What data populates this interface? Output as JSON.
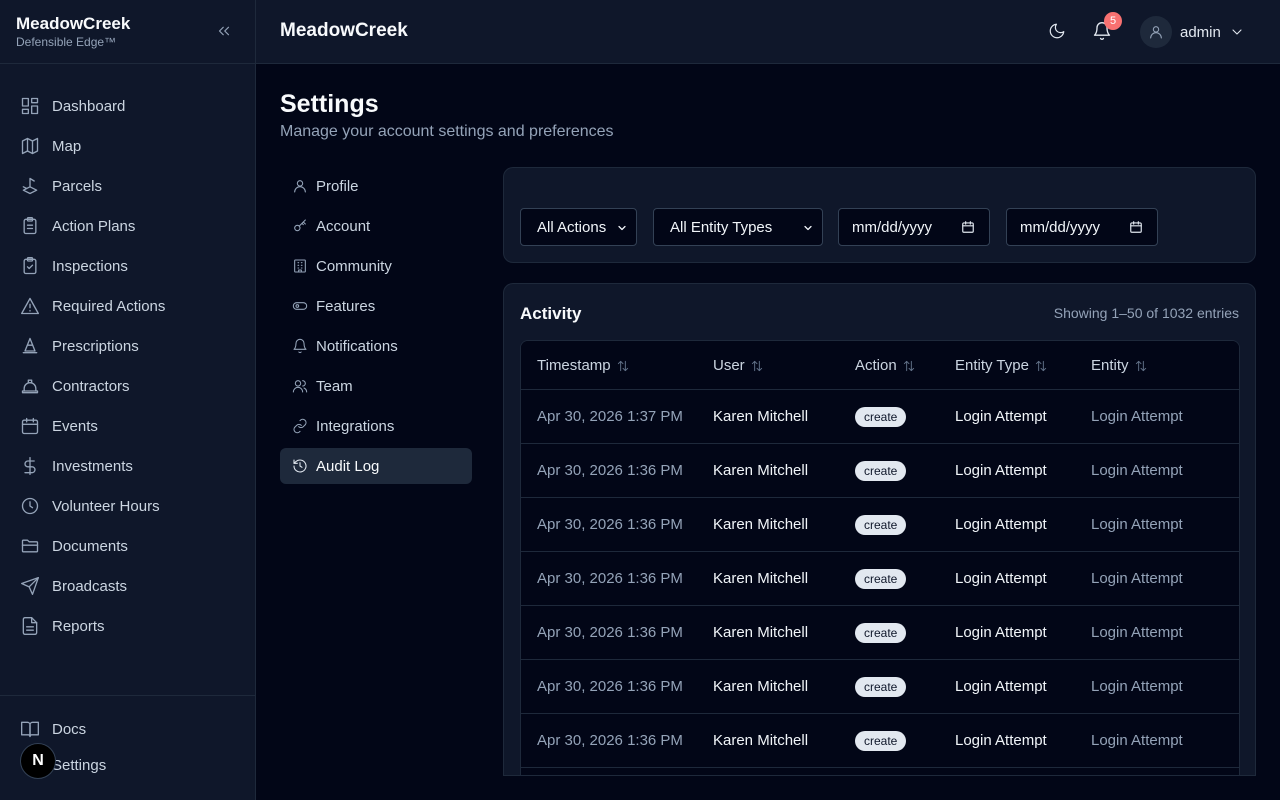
{
  "brand": {
    "title": "MeadowCreek",
    "subtitle": "Defensible Edge™"
  },
  "sidebar": {
    "items": [
      {
        "label": "Dashboard",
        "icon": "dashboard-icon"
      },
      {
        "label": "Map",
        "icon": "map-icon"
      },
      {
        "label": "Parcels",
        "icon": "parcels-icon"
      },
      {
        "label": "Action Plans",
        "icon": "clipboard-icon"
      },
      {
        "label": "Inspections",
        "icon": "clipboard-check-icon"
      },
      {
        "label": "Required Actions",
        "icon": "warning-icon"
      },
      {
        "label": "Prescriptions",
        "icon": "cone-icon"
      },
      {
        "label": "Contractors",
        "icon": "hard-hat-icon"
      },
      {
        "label": "Events",
        "icon": "calendar-icon"
      },
      {
        "label": "Investments",
        "icon": "dollar-icon"
      },
      {
        "label": "Volunteer Hours",
        "icon": "clock-icon"
      },
      {
        "label": "Documents",
        "icon": "folder-icon"
      },
      {
        "label": "Broadcasts",
        "icon": "send-icon"
      },
      {
        "label": "Reports",
        "icon": "file-text-icon"
      }
    ],
    "bottom": [
      {
        "label": "Docs",
        "icon": "book-icon"
      },
      {
        "label": "Settings",
        "icon": "settings-icon"
      }
    ],
    "next_badge": "N"
  },
  "topbar": {
    "title": "MeadowCreek",
    "notifications": "5",
    "user": "admin"
  },
  "page": {
    "title": "Settings",
    "subtitle": "Manage your account settings and preferences"
  },
  "settings_nav": [
    {
      "label": "Profile",
      "icon": "user-icon",
      "active": false
    },
    {
      "label": "Account",
      "icon": "key-icon",
      "active": false
    },
    {
      "label": "Community",
      "icon": "building-icon",
      "active": false
    },
    {
      "label": "Features",
      "icon": "toggle-icon",
      "active": false
    },
    {
      "label": "Notifications",
      "icon": "bell-icon",
      "active": false
    },
    {
      "label": "Team",
      "icon": "users-icon",
      "active": false
    },
    {
      "label": "Integrations",
      "icon": "link-icon",
      "active": false
    },
    {
      "label": "Audit Log",
      "icon": "history-icon",
      "active": true
    }
  ],
  "filters": {
    "action": "All Actions",
    "entity_type": "All Entity Types",
    "date_from": "mm/dd/yyyy",
    "date_to": "mm/dd/yyyy"
  },
  "activity": {
    "title": "Activity",
    "count": "Showing 1–50 of 1032 entries",
    "columns": [
      "Timestamp",
      "User",
      "Action",
      "Entity Type",
      "Entity"
    ],
    "rows": [
      {
        "timestamp": "Apr 30, 2026 1:37 PM",
        "user": "Karen Mitchell",
        "action": "create",
        "entity_type": "Login Attempt",
        "entity": "Login Attempt"
      },
      {
        "timestamp": "Apr 30, 2026 1:36 PM",
        "user": "Karen Mitchell",
        "action": "create",
        "entity_type": "Login Attempt",
        "entity": "Login Attempt"
      },
      {
        "timestamp": "Apr 30, 2026 1:36 PM",
        "user": "Karen Mitchell",
        "action": "create",
        "entity_type": "Login Attempt",
        "entity": "Login Attempt"
      },
      {
        "timestamp": "Apr 30, 2026 1:36 PM",
        "user": "Karen Mitchell",
        "action": "create",
        "entity_type": "Login Attempt",
        "entity": "Login Attempt"
      },
      {
        "timestamp": "Apr 30, 2026 1:36 PM",
        "user": "Karen Mitchell",
        "action": "create",
        "entity_type": "Login Attempt",
        "entity": "Login Attempt"
      },
      {
        "timestamp": "Apr 30, 2026 1:36 PM",
        "user": "Karen Mitchell",
        "action": "create",
        "entity_type": "Login Attempt",
        "entity": "Login Attempt"
      },
      {
        "timestamp": "Apr 30, 2026 1:36 PM",
        "user": "Karen Mitchell",
        "action": "create",
        "entity_type": "Login Attempt",
        "entity": "Login Attempt"
      }
    ]
  },
  "colors": {
    "background": "#020617",
    "panel": "#0f172a",
    "border": "#1e293b",
    "badge": "#f87171"
  }
}
